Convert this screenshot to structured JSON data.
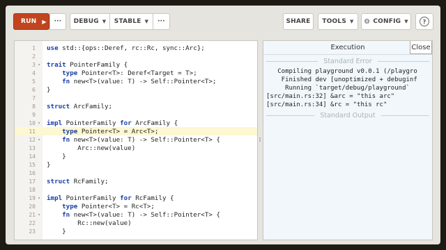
{
  "toolbar": {
    "run_label": "RUN",
    "run_icon": "▶",
    "more_label": "···",
    "debug_label": "DEBUG",
    "stable_label": "STABLE",
    "share_label": "SHARE",
    "tools_label": "TOOLS",
    "config_label": "CONFIG",
    "help_label": "?",
    "accent": "#c1441f"
  },
  "editor": {
    "active_line": 11,
    "lines": [
      {
        "n": "1",
        "fold": "",
        "code": "use std::{ops::Deref, rc::Rc, sync::Arc};"
      },
      {
        "n": "2",
        "fold": "",
        "code": ""
      },
      {
        "n": "3",
        "fold": "▾",
        "code": "trait PointerFamily {"
      },
      {
        "n": "4",
        "fold": "",
        "code": "    type Pointer<T>: Deref<Target = T>;"
      },
      {
        "n": "5",
        "fold": "",
        "code": "    fn new<T>(value: T) -> Self::Pointer<T>;"
      },
      {
        "n": "6",
        "fold": "",
        "code": "}"
      },
      {
        "n": "7",
        "fold": "",
        "code": ""
      },
      {
        "n": "8",
        "fold": "",
        "code": "struct ArcFamily;"
      },
      {
        "n": "9",
        "fold": "",
        "code": ""
      },
      {
        "n": "10",
        "fold": "▾",
        "code": "impl PointerFamily for ArcFamily {"
      },
      {
        "n": "11",
        "fold": "",
        "code": "    type Pointer<T> = Arc<T>;"
      },
      {
        "n": "12",
        "fold": "▾",
        "code": "    fn new<T>(value: T) -> Self::Pointer<T> {"
      },
      {
        "n": "13",
        "fold": "",
        "code": "        Arc::new(value)"
      },
      {
        "n": "14",
        "fold": "",
        "code": "    }"
      },
      {
        "n": "15",
        "fold": "",
        "code": "}"
      },
      {
        "n": "16",
        "fold": "",
        "code": ""
      },
      {
        "n": "17",
        "fold": "",
        "code": "struct RcFamily;"
      },
      {
        "n": "18",
        "fold": "",
        "code": ""
      },
      {
        "n": "19",
        "fold": "▾",
        "code": "impl PointerFamily for RcFamily {"
      },
      {
        "n": "20",
        "fold": "",
        "code": "    type Pointer<T> = Rc<T>;"
      },
      {
        "n": "21",
        "fold": "▾",
        "code": "    fn new<T>(value: T) -> Self::Pointer<T> {"
      },
      {
        "n": "22",
        "fold": "",
        "code": "        Rc::new(value)"
      },
      {
        "n": "23",
        "fold": "",
        "code": "    }"
      }
    ]
  },
  "output": {
    "title": "Execution",
    "close_label": "Close",
    "stderr_heading": "Standard Error",
    "stderr_lines": [
      "   Compiling playground v0.0.1 (/playgro",
      "    Finished dev [unoptimized + debuginf",
      "     Running `target/debug/playground`",
      "[src/main.rs:32] &arc = \"this arc\"",
      "[src/main.rs:34] &rc = \"this rc\""
    ],
    "stdout_heading": "Standard Output"
  }
}
